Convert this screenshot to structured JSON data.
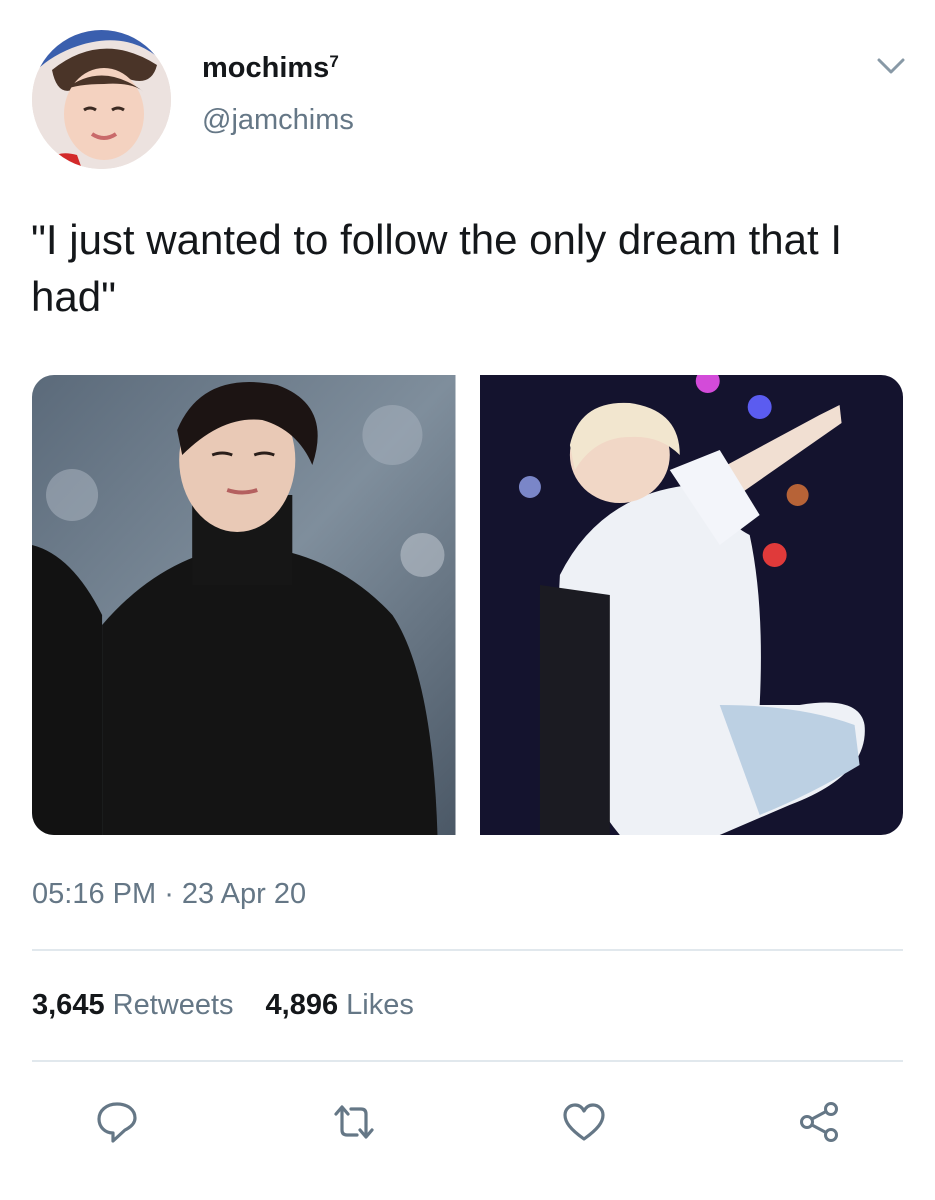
{
  "user": {
    "display_name": "mochims",
    "verified_superscript": "7",
    "handle": "@jamchims"
  },
  "tweet": {
    "text": "\"I just wanted to follow the only dream that I had\"",
    "time": "05:16 PM",
    "separator": " · ",
    "date": "23 Apr 20"
  },
  "stats": {
    "retweets_count": "3,645",
    "retweets_label": "Retweets",
    "likes_count": "4,896",
    "likes_label": "Likes"
  },
  "icons": {
    "menu": "chevron-down-icon",
    "reply": "reply-icon",
    "retweet": "retweet-icon",
    "like": "heart-icon",
    "share": "share-icon"
  },
  "colors": {
    "text_primary": "#14171a",
    "text_secondary": "#657786",
    "divider": "#e1e8ed"
  }
}
